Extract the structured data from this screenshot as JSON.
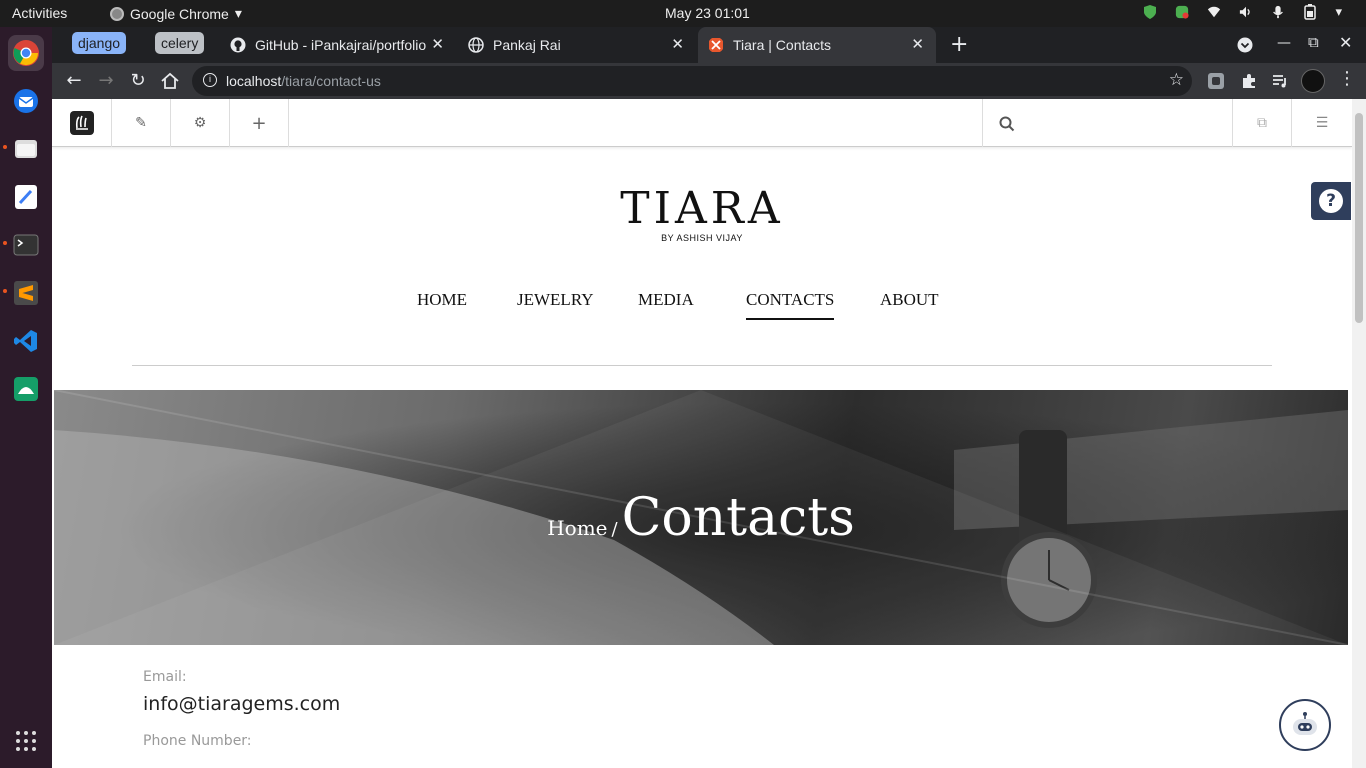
{
  "system": {
    "activities": "Activities",
    "app_name": "Google Chrome",
    "clock": "May 23  01:01"
  },
  "tabs": {
    "groups": [
      {
        "label": "django",
        "color": "#8ab4f8"
      },
      {
        "label": "celery",
        "color": "#bdc1c6"
      }
    ],
    "items": [
      {
        "title": "GitHub - iPankajrai/portfolio",
        "active": false
      },
      {
        "title": "Pankaj Rai",
        "active": false
      },
      {
        "title": "Tiara | Contacts",
        "active": true
      }
    ],
    "new_tab": "+"
  },
  "toolbar": {
    "url_host": "localhost",
    "url_path": "/tiara/contact-us"
  },
  "cms": {
    "icons": [
      "cms-logo-icon",
      "pencil-icon",
      "gear-icon",
      "plus-icon"
    ],
    "search_placeholder": ""
  },
  "site": {
    "logo_main": "TIARA",
    "logo_sub": "BY ASHISH VIJAY",
    "nav": [
      {
        "label": "HOME",
        "active": false
      },
      {
        "label": "JEWELRY",
        "active": false
      },
      {
        "label": "MEDIA",
        "active": false
      },
      {
        "label": "CONTACTS",
        "active": true
      },
      {
        "label": "ABOUT",
        "active": false
      }
    ],
    "hero": {
      "breadcrumb_home": "Home",
      "separator": "/",
      "current": "Contacts"
    },
    "contact": {
      "email_label": "Email:",
      "email_value": "info@tiaragems.com",
      "phone_label": "Phone Number:"
    },
    "help": "?"
  }
}
